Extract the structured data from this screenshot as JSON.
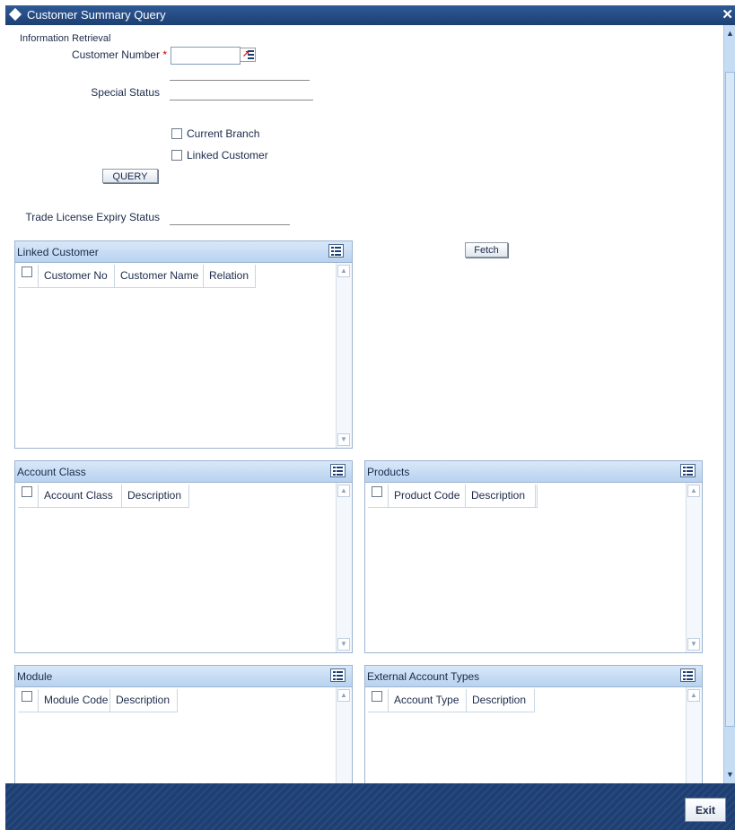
{
  "window": {
    "title": "Customer Summary Query",
    "close": "✕"
  },
  "form": {
    "section": "Information Retrieval",
    "customer_number_label": "Customer Number",
    "required_mark": "*",
    "customer_number_value": "",
    "special_status_label": "Special Status",
    "special_status_value": "",
    "current_branch_label": "Current Branch",
    "linked_customer_label": "Linked Customer",
    "query_button": "QUERY",
    "trade_license_label": "Trade License Expiry Status",
    "trade_license_value": "",
    "fetch_button": "Fetch"
  },
  "panels": {
    "linked_customer": {
      "title": "Linked Customer",
      "columns": [
        "Customer No",
        "Customer Name",
        "Relation"
      ]
    },
    "account_class": {
      "title": "Account Class",
      "columns": [
        "Account Class",
        "Description"
      ]
    },
    "products": {
      "title": "Products",
      "columns": [
        "Product Code",
        "Description"
      ]
    },
    "module": {
      "title": "Module",
      "columns": [
        "Module Code",
        "Description"
      ]
    },
    "external_account_types": {
      "title": "External Account Types",
      "columns": [
        "Account Type",
        "Description"
      ]
    }
  },
  "footer": {
    "exit_button": "Exit"
  },
  "icons": {
    "title": "diamond-icon",
    "lov": "list-of-values-icon",
    "panel": "grid-menu-icon"
  },
  "colors": {
    "titlebar": "#1d3f73",
    "panel_header": "#b8d2ef",
    "footer": "#1d3f73",
    "required": "#d00000"
  }
}
